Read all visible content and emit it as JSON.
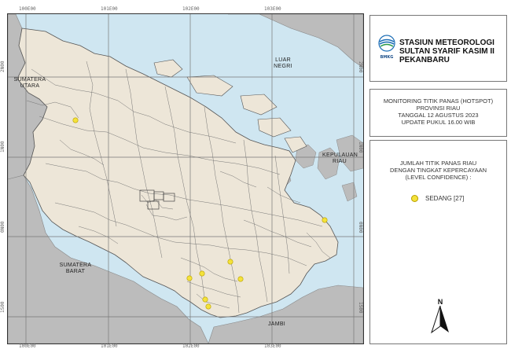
{
  "map": {
    "coord_top": [
      "100E00",
      "101E00",
      "102E00",
      "103E00"
    ],
    "coord_bottom": [
      "100E00",
      "101E00",
      "102E00",
      "103E00"
    ],
    "coord_left": [
      "2N00",
      "1N00",
      "0N00",
      "1S00"
    ],
    "coord_right": [
      "2N00",
      "1N00",
      "0N00",
      "1S00"
    ],
    "labels": {
      "sumatera_utara": "SUMATERA UTARA",
      "luar_negri": "LUAR NEGRI",
      "kepulauan_riau": "KEPULAUAN RIAU",
      "sumatera_barat": "SUMATERA BARAT",
      "jambi": "JAMBI"
    },
    "hotspot_color": "#f4e23a",
    "land_color": "#ede6d8",
    "neighbor_color": "#bcbcbc",
    "sea_color": "#cfe6f1"
  },
  "header": {
    "logo_text": "BMKG",
    "title_lines": [
      "STASIUN METEOROLOGI",
      "SULTAN SYARIF KASIM II",
      "PEKANBARU"
    ]
  },
  "info": {
    "lines": [
      "MONITORING TITIK PANAS (HOTSPOT)",
      "PROVINSI RIAU",
      "TANGGAL 12 AGUSTUS 2023",
      "UPDATE PUKUL 16.00 WIB"
    ]
  },
  "legend": {
    "heading_lines": [
      "JUMLAH TITIK PANAS RIAU",
      "DENGAN TINGKAT KEPERCAYAAN",
      "(LEVEL CONFIDENCE) :"
    ],
    "items": [
      {
        "label": "SEDANG [27]",
        "color": "#f4e23a"
      }
    ],
    "north_label": "N"
  }
}
